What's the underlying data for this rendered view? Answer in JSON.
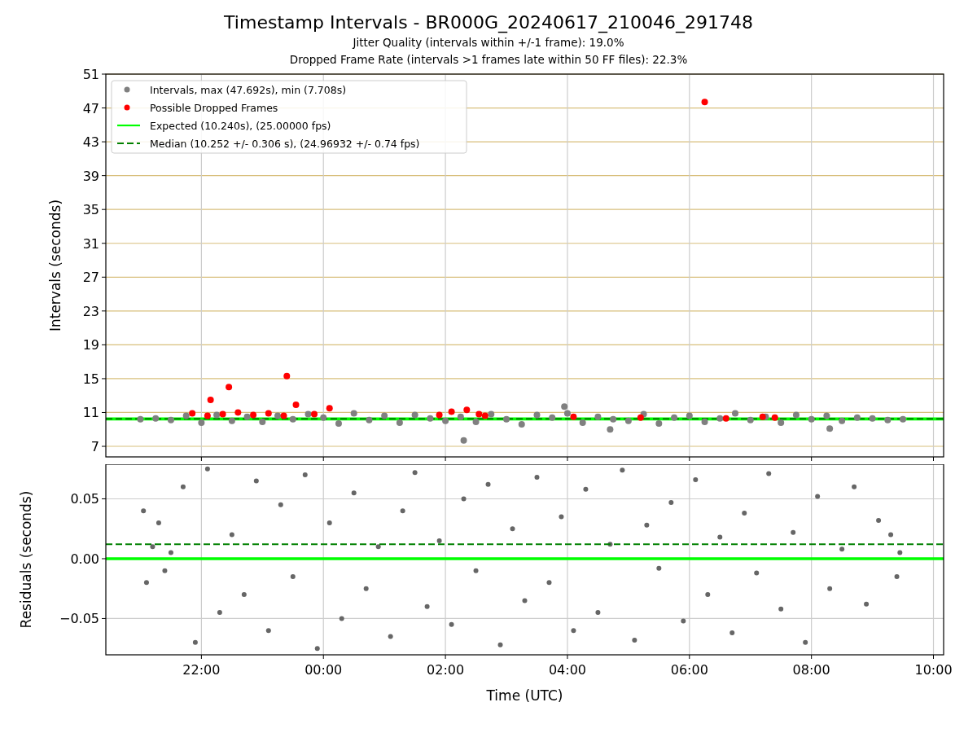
{
  "figure": {
    "title": "Timestamp Intervals - BR000G_20240617_210046_291748",
    "subtitles": [
      "Jitter Quality (intervals within +/-1 frame): 19.0%",
      "Dropped Frame Rate (intervals >1 frames late within 50 FF files): 22.3%"
    ]
  },
  "intervals_panel": {
    "chart_data": {
      "type": "scatter",
      "ylabel": "Intervals (seconds)",
      "grid": true,
      "legend": true,
      "xlim": [
        "2024-06-17 20:26",
        "2024-06-18 10:10"
      ],
      "ylim": [
        5.75,
        51
      ],
      "yticks": [
        {
          "value": 7,
          "label": "7"
        },
        {
          "value": 11,
          "label": "11"
        },
        {
          "value": 15,
          "label": "15"
        },
        {
          "value": 19,
          "label": "19"
        },
        {
          "value": 23,
          "label": "23"
        },
        {
          "value": 27,
          "label": "27"
        },
        {
          "value": 31,
          "label": "31"
        },
        {
          "value": 35,
          "label": "35"
        },
        {
          "value": 39,
          "label": "39"
        },
        {
          "value": 43,
          "label": "43"
        },
        {
          "value": 47,
          "label": "47"
        },
        {
          "value": 51,
          "label": "51"
        }
      ],
      "series": [
        {
          "name": "Intervals, max (47.692s), min (7.708s)",
          "type": "scatter",
          "color": "#808080",
          "x": [
            "2024-06-17 21:00",
            "2024-06-17 21:15",
            "2024-06-17 21:30",
            "2024-06-17 21:45",
            "2024-06-17 22:00",
            "2024-06-17 22:15",
            "2024-06-17 22:30",
            "2024-06-17 22:45",
            "2024-06-17 23:00",
            "2024-06-17 23:15",
            "2024-06-17 23:30",
            "2024-06-17 23:45",
            "2024-06-18 00:00",
            "2024-06-18 00:15",
            "2024-06-18 00:30",
            "2024-06-18 00:45",
            "2024-06-18 01:00",
            "2024-06-18 01:15",
            "2024-06-18 01:30",
            "2024-06-18 01:45",
            "2024-06-18 02:00",
            "2024-06-18 02:15",
            "2024-06-18 02:30",
            "2024-06-18 02:45",
            "2024-06-18 03:00",
            "2024-06-18 03:15",
            "2024-06-18 03:30",
            "2024-06-18 03:45",
            "2024-06-18 04:00",
            "2024-06-18 04:15",
            "2024-06-18 04:30",
            "2024-06-18 04:45",
            "2024-06-18 05:00",
            "2024-06-18 05:15",
            "2024-06-18 05:30",
            "2024-06-18 05:45",
            "2024-06-18 06:00",
            "2024-06-18 06:15",
            "2024-06-18 06:30",
            "2024-06-18 06:45",
            "2024-06-18 07:00",
            "2024-06-18 07:15",
            "2024-06-18 07:30",
            "2024-06-18 07:45",
            "2024-06-18 08:00",
            "2024-06-18 08:15",
            "2024-06-18 08:30",
            "2024-06-18 08:45",
            "2024-06-18 09:00",
            "2024-06-18 09:15",
            "2024-06-18 09:30",
            "2024-06-18 02:18",
            "2024-06-18 03:57",
            "2024-06-18 04:42",
            "2024-06-18 08:18"
          ],
          "values": [
            10.2,
            10.3,
            10.1,
            10.6,
            9.8,
            10.7,
            10.0,
            10.5,
            9.9,
            10.6,
            10.2,
            10.8,
            10.4,
            9.7,
            10.9,
            10.1,
            10.6,
            9.8,
            10.7,
            10.3,
            10.0,
            10.5,
            9.9,
            10.8,
            10.2,
            9.6,
            10.7,
            10.4,
            10.9,
            9.8,
            10.5,
            10.2,
            10.0,
            10.8,
            9.7,
            10.4,
            10.6,
            9.9,
            10.3,
            10.9,
            10.1,
            10.5,
            9.8,
            10.7,
            10.2,
            10.6,
            10.0,
            10.4,
            10.3,
            10.1,
            10.2,
            7.708,
            11.7,
            9.0,
            9.1
          ]
        },
        {
          "name": "Possible Dropped Frames",
          "type": "scatter",
          "color": "#ff0000",
          "x": [
            "2024-06-17 21:51",
            "2024-06-17 22:06",
            "2024-06-17 22:09",
            "2024-06-17 22:21",
            "2024-06-17 22:27",
            "2024-06-17 22:36",
            "2024-06-17 22:51",
            "2024-06-17 23:06",
            "2024-06-17 23:21",
            "2024-06-17 23:24",
            "2024-06-17 23:33",
            "2024-06-17 23:51",
            "2024-06-18 00:06",
            "2024-06-18 01:54",
            "2024-06-18 02:06",
            "2024-06-18 02:21",
            "2024-06-18 02:33",
            "2024-06-18 02:39",
            "2024-06-18 04:06",
            "2024-06-18 05:12",
            "2024-06-18 06:15",
            "2024-06-18 06:36",
            "2024-06-18 07:12",
            "2024-06-18 07:24"
          ],
          "values": [
            10.9,
            10.6,
            12.5,
            10.8,
            14.0,
            11.0,
            10.7,
            10.9,
            10.6,
            15.3,
            11.9,
            10.8,
            11.5,
            10.7,
            11.1,
            11.3,
            10.8,
            10.6,
            10.5,
            10.4,
            47.692,
            10.3,
            10.5,
            10.4
          ]
        },
        {
          "name": "Expected (10.240s), (25.00000 fps)",
          "type": "line",
          "color": "#00ff00",
          "x": [
            "2024-06-17 20:26",
            "2024-06-18 10:10"
          ],
          "values": [
            10.24,
            10.24
          ]
        },
        {
          "name": "Median (10.252 +/- 0.306 s), (24.96932 +/- 0.74 fps)",
          "type": "line",
          "line_style": "dashed",
          "color": "#008000",
          "x": [
            "2024-06-17 20:26",
            "2024-06-18 10:10"
          ],
          "values": [
            10.252,
            10.252
          ]
        }
      ]
    }
  },
  "residuals_panel": {
    "chart_data": {
      "type": "scatter",
      "xlabel": "Time (UTC)",
      "ylabel": "Residuals (seconds)",
      "grid": true,
      "xlim": [
        "2024-06-17 20:26",
        "2024-06-18 10:10"
      ],
      "ylim": [
        -0.0803,
        0.0789
      ],
      "xticks": [
        {
          "value": "2024-06-17 22:00",
          "label": "22:00"
        },
        {
          "value": "2024-06-18 00:00",
          "label": "00:00"
        },
        {
          "value": "2024-06-18 02:00",
          "label": "02:00"
        },
        {
          "value": "2024-06-18 04:00",
          "label": "04:00"
        },
        {
          "value": "2024-06-18 06:00",
          "label": "06:00"
        },
        {
          "value": "2024-06-18 08:00",
          "label": "08:00"
        },
        {
          "value": "2024-06-18 10:00",
          "label": "10:00"
        }
      ],
      "yticks": [
        {
          "value": -0.05,
          "label": "−0.05"
        },
        {
          "value": 0,
          "label": "0.00"
        },
        {
          "value": 0.05,
          "label": "0.05"
        }
      ],
      "series": [
        {
          "type": "scatter",
          "color": "#666666",
          "x": [
            "2024-06-17 21:03",
            "2024-06-17 21:06",
            "2024-06-17 21:12",
            "2024-06-17 21:18",
            "2024-06-17 21:24",
            "2024-06-17 21:30",
            "2024-06-17 21:42",
            "2024-06-17 21:54",
            "2024-06-17 22:06",
            "2024-06-17 22:18",
            "2024-06-17 22:30",
            "2024-06-17 22:42",
            "2024-06-17 22:54",
            "2024-06-17 23:06",
            "2024-06-17 23:18",
            "2024-06-17 23:30",
            "2024-06-17 23:42",
            "2024-06-17 23:54",
            "2024-06-18 00:06",
            "2024-06-18 00:18",
            "2024-06-18 00:30",
            "2024-06-18 00:42",
            "2024-06-18 00:54",
            "2024-06-18 01:06",
            "2024-06-18 01:18",
            "2024-06-18 01:30",
            "2024-06-18 01:42",
            "2024-06-18 01:54",
            "2024-06-18 02:06",
            "2024-06-18 02:18",
            "2024-06-18 02:30",
            "2024-06-18 02:42",
            "2024-06-18 02:54",
            "2024-06-18 03:06",
            "2024-06-18 03:18",
            "2024-06-18 03:30",
            "2024-06-18 03:42",
            "2024-06-18 03:54",
            "2024-06-18 04:06",
            "2024-06-18 04:18",
            "2024-06-18 04:30",
            "2024-06-18 04:42",
            "2024-06-18 04:54",
            "2024-06-18 05:06",
            "2024-06-18 05:18",
            "2024-06-18 05:30",
            "2024-06-18 05:42",
            "2024-06-18 05:54",
            "2024-06-18 06:06",
            "2024-06-18 06:18",
            "2024-06-18 06:30",
            "2024-06-18 06:42",
            "2024-06-18 06:54",
            "2024-06-18 07:06",
            "2024-06-18 07:18",
            "2024-06-18 07:30",
            "2024-06-18 07:42",
            "2024-06-18 07:54",
            "2024-06-18 08:06",
            "2024-06-18 08:18",
            "2024-06-18 08:30",
            "2024-06-18 08:42",
            "2024-06-18 08:54",
            "2024-06-18 09:06",
            "2024-06-18 09:18",
            "2024-06-18 09:24",
            "2024-06-18 09:27"
          ],
          "values": [
            0.04,
            -0.02,
            0.01,
            0.03,
            -0.01,
            0.005,
            0.06,
            -0.07,
            0.075,
            -0.045,
            0.02,
            -0.03,
            0.065,
            -0.06,
            0.045,
            -0.015,
            0.07,
            -0.075,
            0.03,
            -0.05,
            0.055,
            -0.025,
            0.01,
            -0.065,
            0.04,
            0.072,
            -0.04,
            0.015,
            -0.055,
            0.05,
            -0.01,
            0.062,
            -0.072,
            0.025,
            -0.035,
            0.068,
            -0.02,
            0.035,
            -0.06,
            0.058,
            -0.045,
            0.012,
            0.074,
            -0.068,
            0.028,
            -0.008,
            0.047,
            -0.052,
            0.066,
            -0.03,
            0.018,
            -0.062,
            0.038,
            -0.012,
            0.071,
            -0.042,
            0.022,
            -0.07,
            0.052,
            -0.025,
            0.008,
            0.06,
            -0.038,
            0.032,
            0.02,
            -0.015,
            0.005
          ]
        },
        {
          "type": "line",
          "color": "#00ff00",
          "x": [
            "2024-06-17 20:26",
            "2024-06-18 10:10"
          ],
          "values": [
            0,
            0
          ]
        },
        {
          "type": "line",
          "line_style": "dashed",
          "color": "#008000",
          "x": [
            "2024-06-17 20:26",
            "2024-06-18 10:10"
          ],
          "values": [
            0.012,
            0.012
          ]
        }
      ]
    }
  }
}
